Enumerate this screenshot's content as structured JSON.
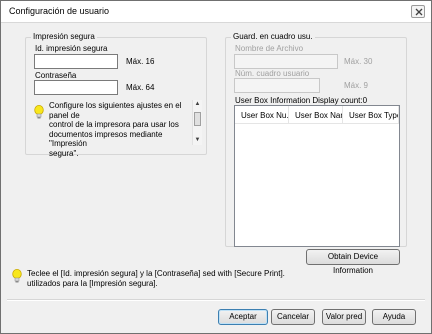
{
  "window": {
    "title": "Configuración de usuario"
  },
  "secure_print": {
    "legend": "Impresión segura",
    "id_label": "Id. impresión segura",
    "id_value": "",
    "id_max": "Máx. 16",
    "password_label": "Contraseña",
    "password_value": "",
    "password_max": "Máx. 64",
    "info_line1": "Configure los siguientes ajustes en el panel de",
    "info_line2": "control de la impresora para usar los",
    "info_line3": "documentos impresos mediante \"Impresión",
    "info_line4": "segura\"."
  },
  "user_box": {
    "legend": "Guard. en cuadro usu.",
    "filename_label": "Nombre de Archivo",
    "filename_value": "",
    "filename_max": "Máx. 30",
    "box_number_label": "Núm. cuadro usuario",
    "box_number_value": "",
    "box_number_max": "Máx. 9",
    "info_title": "User Box Information  Display count:0",
    "columns": [
      "User Box Nu...",
      "User Box Name",
      "User Box Type"
    ],
    "obtain_button": "Obtain Device Information"
  },
  "footer": {
    "message_line1": "Teclee el [Id. impresión segura] y la [Contraseña]       sed with [Secure Print].",
    "message_line2": "utilizados para la [Impresión segura]."
  },
  "buttons": {
    "ok": "Aceptar",
    "cancel": "Cancelar",
    "default": "Valor pred",
    "help": "Ayuda"
  }
}
